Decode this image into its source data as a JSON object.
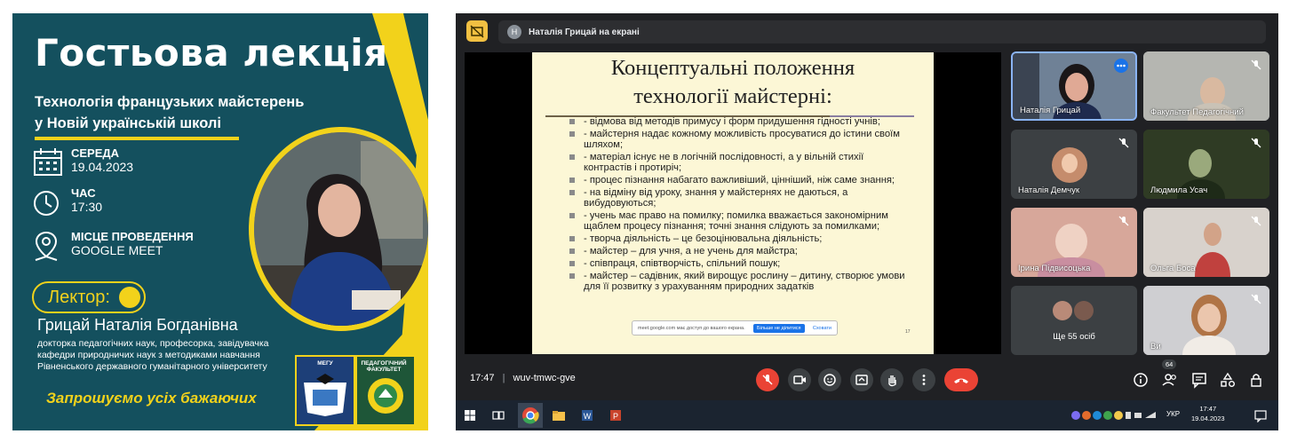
{
  "poster": {
    "title": "Гостьова лекція",
    "subtitle_line1": "Технологія французьких майстерень",
    "subtitle_line2": "у Новій українській школі",
    "day_label": "СЕРЕДА",
    "date": "19.04.2023",
    "time_label": "ЧАС",
    "time": "17:30",
    "place_label": "МІСЦЕ ПРОВЕДЕННЯ",
    "place": "GOOGLE MEET",
    "lector_label": "Лектор:",
    "lector_name": "Грицай Наталія Богданівна",
    "lector_desc": "докторка педагогічних наук, професорка, завідувачка кафедри природничих наук з методиками навчання Рівненського державного гуманітарного університету",
    "invite": "Запрошуємо усіх бажаючих",
    "logo1_text": "МЕГУ",
    "logo2_text": "ПЕДАГОГІЧНИЙ ФАКУЛЬТЕТ",
    "accent_color": "#f2d21b",
    "bg_color": "#14505e"
  },
  "meet": {
    "presenter_initial": "Н",
    "presenting_title": "Наталія Грицай на екрані",
    "slide": {
      "heading_line1": "Концептуальні положення",
      "heading_line2": "технології майстерні:",
      "bullets": [
        "- відмова від методів примусу і форм придушення гідності учнів;",
        "- майстерня надає кожному можливість просуватися до істини своїм шляхом;",
        "- матеріал існує не в логічній послідовності, а у вільній стихії контрастів і протиріч;",
        "- процес пізнання набагато важливіший, цінніший, ніж саме знання;",
        "- на відміну від уроку, знання у майстернях не даються, а вибудовуються;",
        "- учень має право на помилку; помилка вважається закономірним щаблем процесу пізнання; точні знання слідують за помилками;",
        "- творча діяльність – це безоцінювальна діяльність;",
        "- майстер – для учня, а не учень для майстра;",
        "- співпраця, співтворчість, спільний пошук;",
        "- майстер – садівник, який вирощує рослину – дитину, створює умови для її розвитку з урахуванням природних задатків"
      ],
      "popup_text": "meet.google.com має доступ до вашого екрана.",
      "popup_button": "Більше не ділитися",
      "popup_link": "Сховати",
      "page_number": "17"
    },
    "participants": [
      {
        "name": "Наталія Грицай"
      },
      {
        "name": "Факультет Педагогічний"
      },
      {
        "name": "Наталія Демчук"
      },
      {
        "name": "Людмила Усач"
      },
      {
        "name": "Ірина Підвисоцька"
      },
      {
        "name": "Ольга Боса"
      },
      {
        "name": "Ще 55 осіб"
      },
      {
        "name": "Ви"
      }
    ],
    "time": "17:47",
    "meeting_code": "wuv-tmwc-gve",
    "participants_count": "64"
  },
  "taskbar": {
    "language": "УКР",
    "clock_time": "17:47",
    "clock_date": "19.04.2023"
  }
}
